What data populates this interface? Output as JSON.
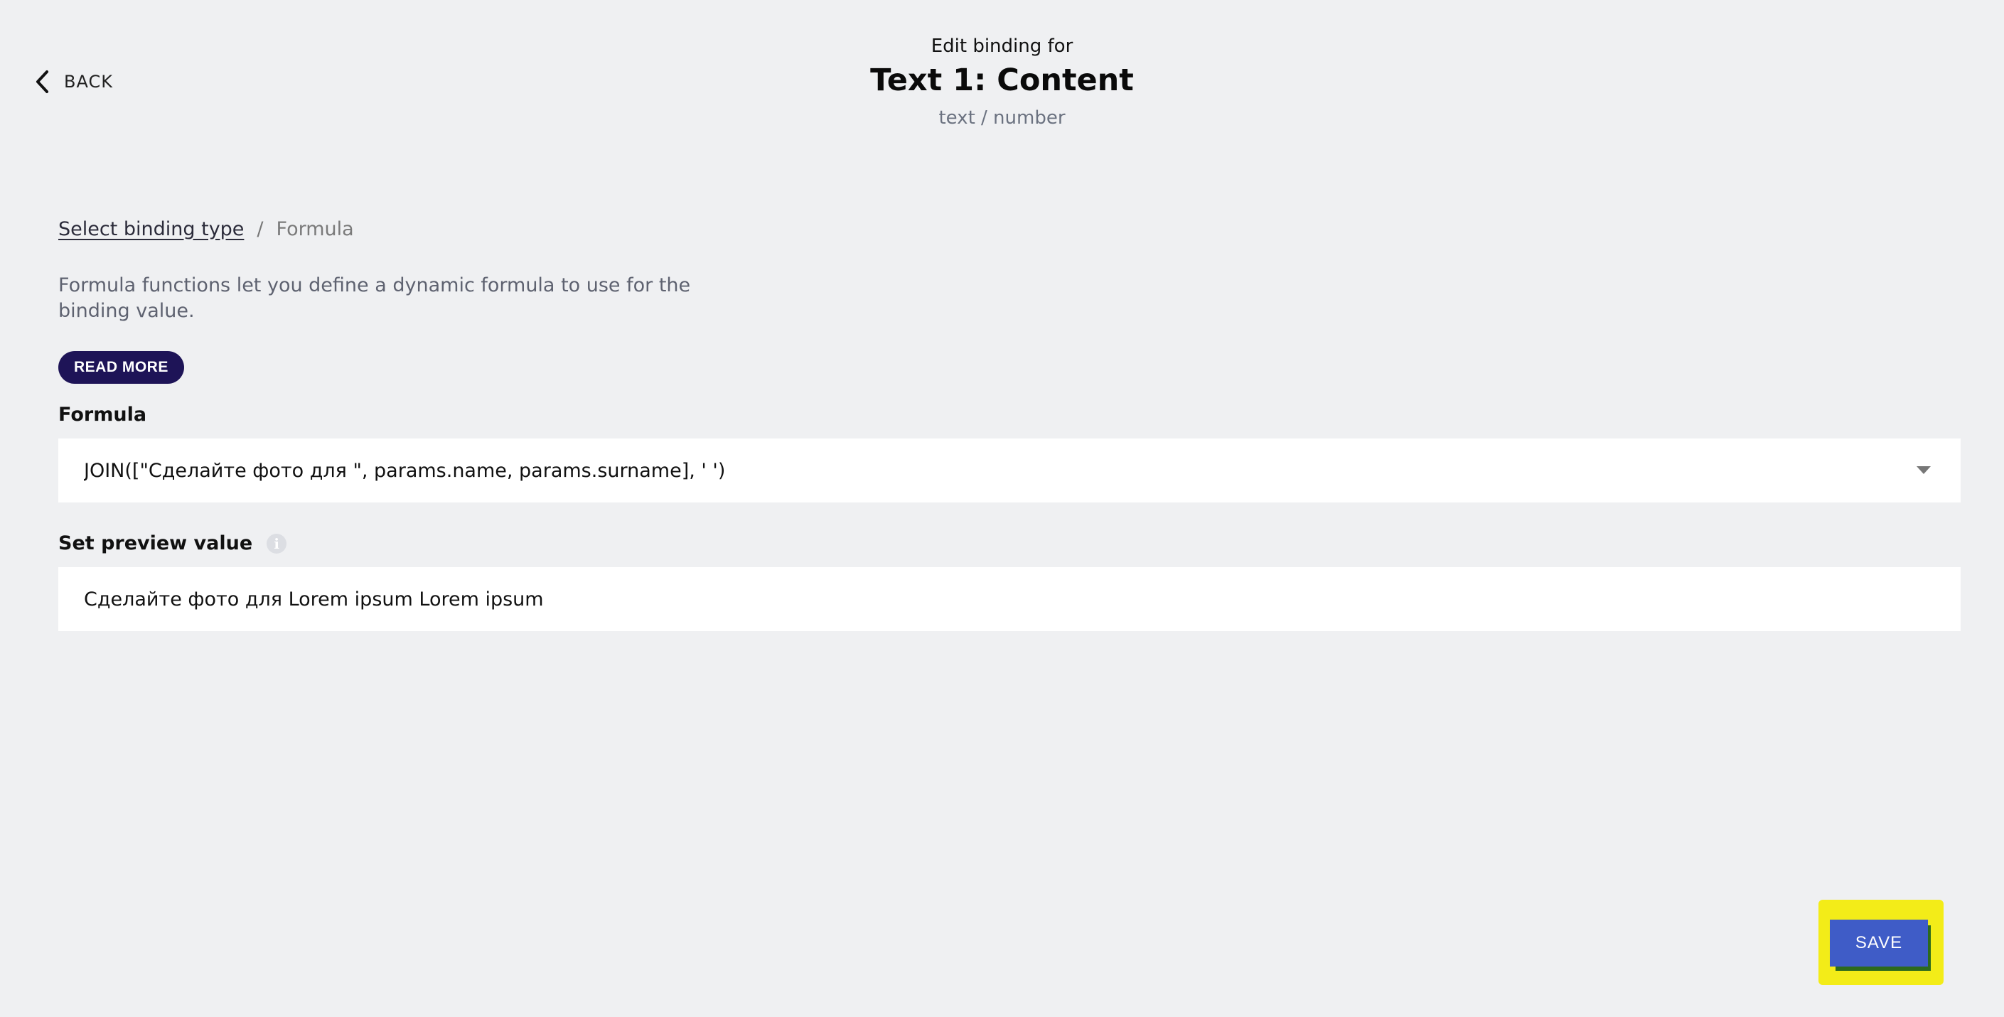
{
  "header": {
    "back_label": "BACK",
    "subtitle": "Edit binding for",
    "title": "Text 1: Content",
    "type": "text / number"
  },
  "breadcrumb": {
    "link": "Select binding type",
    "separator": "/",
    "current": "Formula"
  },
  "description": "Formula functions let you define a dynamic formula to use for the binding value.",
  "read_more_label": "READ MORE",
  "formula": {
    "label": "Formula",
    "value": "JOIN([\"Сделайте фото для \", params.name, params.surname], ' ')"
  },
  "preview": {
    "label": "Set preview value",
    "value": "Сделайте фото для  Lorem ipsum Lorem ipsum"
  },
  "save_label": "SAVE",
  "colors": {
    "background": "#eff0f2",
    "read_more_bg": "#1e1457",
    "save_bg": "#3f5cc7",
    "highlight": "#f3ec18"
  },
  "icons": {
    "back": "chevron-left-icon",
    "info": "info-icon",
    "dropdown": "chevron-down-icon"
  }
}
